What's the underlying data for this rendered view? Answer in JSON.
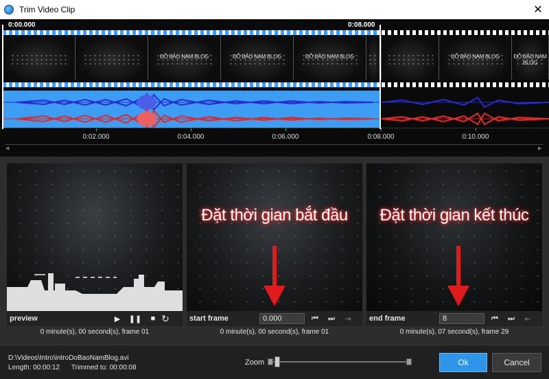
{
  "window": {
    "title": "Trim Video Clip"
  },
  "timeline": {
    "start_time": "0:00.000",
    "end_time": "0:08.000",
    "frame_text": "ĐỖ BẢO NAM BLOG",
    "ruler_labels": [
      "0:02.000",
      "0:04.000",
      "0:06.000",
      "0:08.000",
      "0:10.000"
    ]
  },
  "panels": {
    "preview": {
      "label": "preview",
      "status": "0 minute(s), 00 second(s), frame 01"
    },
    "start": {
      "label": "start frame",
      "value": "0.000",
      "status": "0 minute(s), 00 second(s), frame 01",
      "overlay": "Đặt thời gian bắt đầu"
    },
    "end": {
      "label": "end frame",
      "value": "8",
      "status": "0 minute(s), 07 second(s), frame 29",
      "overlay": "Đặt thời gian kết thúc"
    }
  },
  "footer": {
    "file_path": "D:\\Videos\\Intro\\introDoBaoNamBlog.avi",
    "length_label": "Length:",
    "length_value": "00:00:12",
    "trimmed_label": "Trimmed to:",
    "trimmed_value": "00:00:08",
    "zoom_label": "Zoom",
    "ok_label": "Ok",
    "cancel_label": "Cancel"
  },
  "icons": {
    "play": "play-icon",
    "pause": "pause-icon",
    "stop": "stop-icon",
    "loop": "loop-icon",
    "prev": "skip-to-start-icon",
    "next": "skip-to-end-icon",
    "set": "set-marker-icon"
  },
  "colors": {
    "accent": "#2f95e8",
    "audio_selected": "#3d9df2",
    "annotation": "#e01b1b"
  }
}
